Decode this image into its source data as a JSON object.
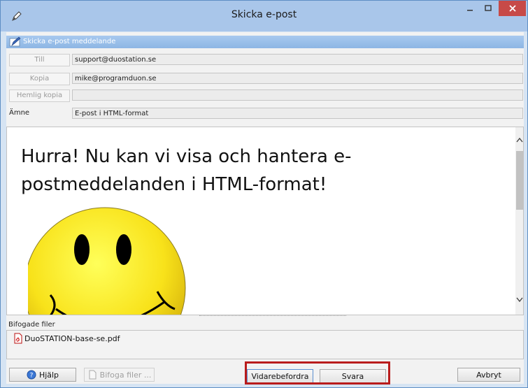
{
  "window": {
    "title": "Skicka e-post"
  },
  "header": {
    "label": "Skicka e-post meddelande"
  },
  "fields": {
    "till": {
      "label": "Till",
      "value": "support@duostation.se"
    },
    "kopia": {
      "label": "Kopia",
      "value": "mike@programduon.se"
    },
    "hemlig": {
      "label": "Hemlig kopia",
      "value": ""
    },
    "amne": {
      "label": "Ämne",
      "value": "E-post i HTML-format"
    }
  },
  "body": {
    "text": "Hurra! Nu kan vi visa och hantera e-postmeddelanden i HTML-format!"
  },
  "attachments": {
    "label": "Bifogade filer",
    "files": [
      "DuoSTATION-base-se.pdf"
    ]
  },
  "buttons": {
    "help": "Hjälp",
    "attach": "Bifoga filer ...",
    "forward": "Vidarebefordra",
    "reply": "Svara",
    "cancel": "Avbryt"
  },
  "colors": {
    "highlight": "#b91c1c",
    "titlebar": "#a9c6ea",
    "close": "#c74a48"
  }
}
